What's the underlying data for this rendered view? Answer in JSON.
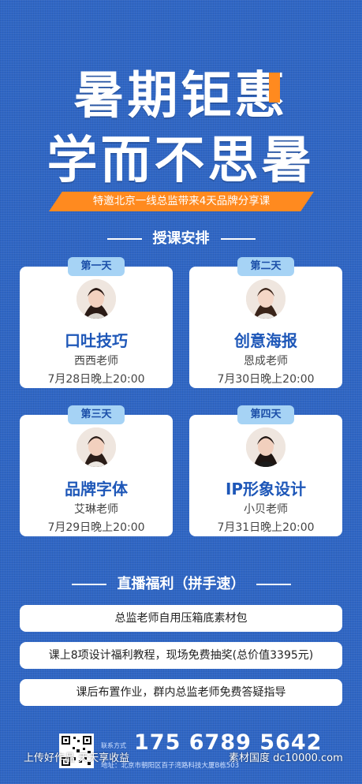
{
  "headline": {
    "line1": "暑期钜惠",
    "line2": "学而不思暑"
  },
  "ribbon": "特邀北京一线总监带来4天品牌分享课",
  "schedule": {
    "title": "授课安排",
    "cards": [
      {
        "day": "第一天",
        "title": "口吐技巧",
        "teacher": "西西老师",
        "time": "7月28日晚上20:00"
      },
      {
        "day": "第二天",
        "title": "创意海报",
        "teacher": "恩成老师",
        "time": "7月30日晚上20:00"
      },
      {
        "day": "第三天",
        "title": "品牌字体",
        "teacher": "艾琳老师",
        "time": "7月29日晚上20:00"
      },
      {
        "day": "第四天",
        "title": "IP形象设计",
        "teacher": "小贝老师",
        "time": "7月31日晚上20:00"
      }
    ]
  },
  "benefits": {
    "title": "直播福利（拼手速）",
    "items": [
      "总监老师自用压箱底素材包",
      "课上8项设计福利教程，现场免费抽奖(总价值3395元)",
      "课后布置作业，群内总监老师免费答疑指导"
    ]
  },
  "footer": {
    "contact_label": "联系方式",
    "phone": "175 6789 5642",
    "address": "地址：北京市朝阳区百子湾路科技大厦B栋503"
  },
  "watermark": {
    "left": "上传好作品 天天享收益",
    "right": "素材国度 dc10000.com"
  },
  "colors": {
    "background": "#2f66c4",
    "accent": "#ff8a1f",
    "tag": "#a6d3f5",
    "title_blue": "#1e57b8"
  }
}
